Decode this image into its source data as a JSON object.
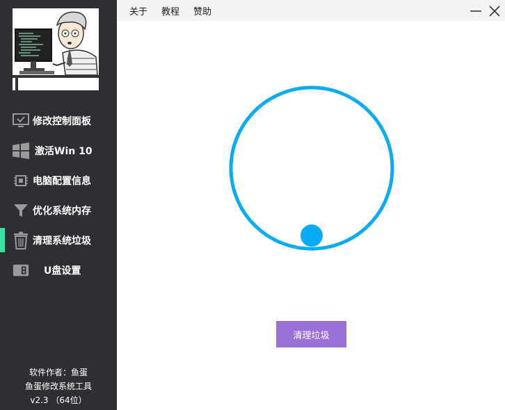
{
  "menu": {
    "items": [
      {
        "label": "关于"
      },
      {
        "label": "教程"
      },
      {
        "label": "赞助"
      }
    ]
  },
  "sidebar": {
    "items": [
      {
        "label": "修改控制面板",
        "icon": "monitor-check-icon"
      },
      {
        "label": "激活Win 10",
        "icon": "windows-logo-icon"
      },
      {
        "label": "电脑配置信息",
        "icon": "chip-icon"
      },
      {
        "label": "优化系统内存",
        "icon": "funnel-icon"
      },
      {
        "label": "清理系统垃圾",
        "icon": "trash-icon",
        "active": true
      },
      {
        "label": "U盘设置",
        "icon": "usb-drive-icon"
      }
    ],
    "credits": {
      "author": "软件作者：鱼蛋",
      "app_name": "鱼蛋修改系统工具",
      "version": "v2.3 （64位）"
    }
  },
  "main": {
    "clean_button_label": "清理垃圾"
  },
  "colors": {
    "sidebar_bg": "#2f2f33",
    "active_indicator": "#3ce0a0",
    "ring": "#0aabf5",
    "button": "#9b6fd8"
  }
}
